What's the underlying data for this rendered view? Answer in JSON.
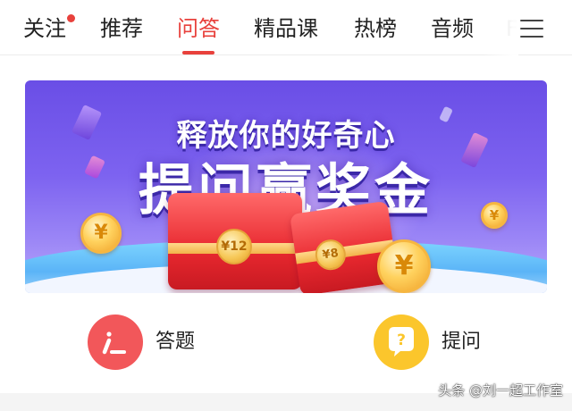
{
  "tabs": [
    {
      "label": "关注",
      "has_dot": true
    },
    {
      "label": "推荐"
    },
    {
      "label": "问答",
      "active": true
    },
    {
      "label": "精品课"
    },
    {
      "label": "热榜"
    },
    {
      "label": "音频"
    },
    {
      "label": "F"
    }
  ],
  "banner": {
    "title_line1": "释放你的好奇心",
    "title_line2": "提问赢奖金",
    "envelope_left_amount": "¥12",
    "envelope_right_amount": "¥8",
    "coin_symbol": "¥"
  },
  "actions": {
    "answer": {
      "label": "答题",
      "color": "#f2575a"
    },
    "ask": {
      "label": "提问",
      "color": "#fbc62c",
      "icon_glyph": "?"
    }
  },
  "watermark": "头条 @刘一超工作室",
  "colors": {
    "accent": "#e8413c"
  }
}
